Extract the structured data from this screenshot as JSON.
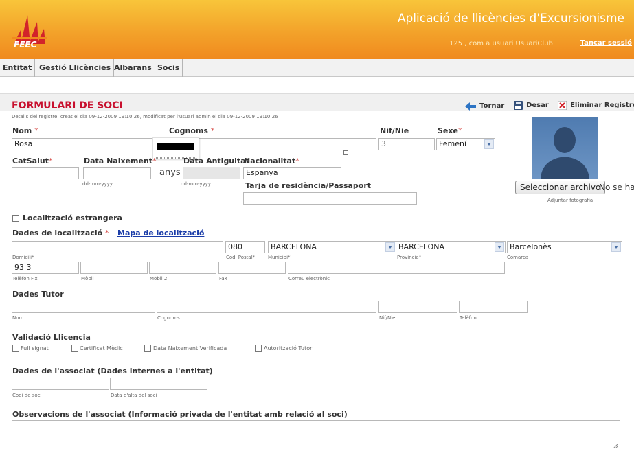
{
  "header": {
    "app_title": "Aplicació de llicències d'Excursionisme",
    "logo_text": "FEEC",
    "user_info": "125 , com a usuari UsuariClub",
    "logout_label": "Tancar sessió"
  },
  "menu": {
    "items": [
      "Entitat",
      "Gestió Llicències",
      "Albarans",
      "Socis"
    ]
  },
  "toolbar": {
    "back_label": "Tornar",
    "save_label": "Desar",
    "delete_label": "Eliminar Registre"
  },
  "form": {
    "title": "FORMULARI DE SOCI",
    "details": "Detalls del registre: creat el dia 09-12-2009 19:10:26, modificat per l'usuari admin el dia 09-12-2009 19:10:26",
    "nom_label": "Nom",
    "nom_value": "Rosa",
    "cognoms_label": "Cognoms",
    "nif_label": "Nif/Nie",
    "nif_value": "3",
    "sexe_label": "Sexe",
    "sexe_value": "Femení",
    "catsalut_label": "CatSalut",
    "data_naix_label": "Data Naixement",
    "data_naix_hint": "dd-mm-yyyy",
    "anys_label": "anys",
    "data_antig_label": "Data Antiguitat",
    "data_antig_hint": "dd-mm-yyyy",
    "nacionalitat_label": "Nacionalitat",
    "nacionalitat_value": "Espanya",
    "tarja_label": "Tarja de residència/Passaport",
    "photo_button": "Seleccionar archivo",
    "photo_status": "No se ha",
    "photo_caption": "Adjuntar fotografia",
    "required_mark": "*"
  },
  "localitzacio": {
    "foreign_label": "Localització estrangera",
    "title": "Dades de localització",
    "map_link": "Mapa de localització",
    "postal_value": "080",
    "municipi_value": "BARCELONA",
    "provincia_value": "BARCELONA",
    "comarca_value": "Barcelonès",
    "domicili_label": "Domicili*",
    "postal_label": "Codi Postal*",
    "municipi_label": "Municipi*",
    "provincia_label": "Província*",
    "comarca_label": "Comarca",
    "telefon_value": "93 3",
    "telefon_label": "Telèfon Fix",
    "mobil_label": "Mòbil",
    "mobil2_label": "Mòbil 2",
    "fax_label": "Fax",
    "email_label": "Correu electrònic"
  },
  "tutor": {
    "title": "Dades Tutor",
    "nom_label": "Nom",
    "cognoms_label": "Cognoms",
    "nif_label": "Nif/Nie",
    "telefon_label": "Telèfon"
  },
  "validacio": {
    "title": "Validació Llicencia",
    "items": [
      "Full signat",
      "Certificat Mèdic",
      "Data Naixement Verificada",
      "Autorització Tutor"
    ]
  },
  "associat": {
    "title": "Dades de l'associat (Dades internes a l'entitat)",
    "codi_label": "Codi de soci",
    "data_alta_label": "Data d'alta del soci"
  },
  "observacions": {
    "title": "Observacions de l'associat (Informació privada de l'entitat amb relació al soci)"
  },
  "colors": {
    "header_gradient_start": "#f7c02a",
    "header_gradient_end": "#f08a1e",
    "title_red": "#c8102e",
    "link_blue": "#1a3ca8"
  }
}
